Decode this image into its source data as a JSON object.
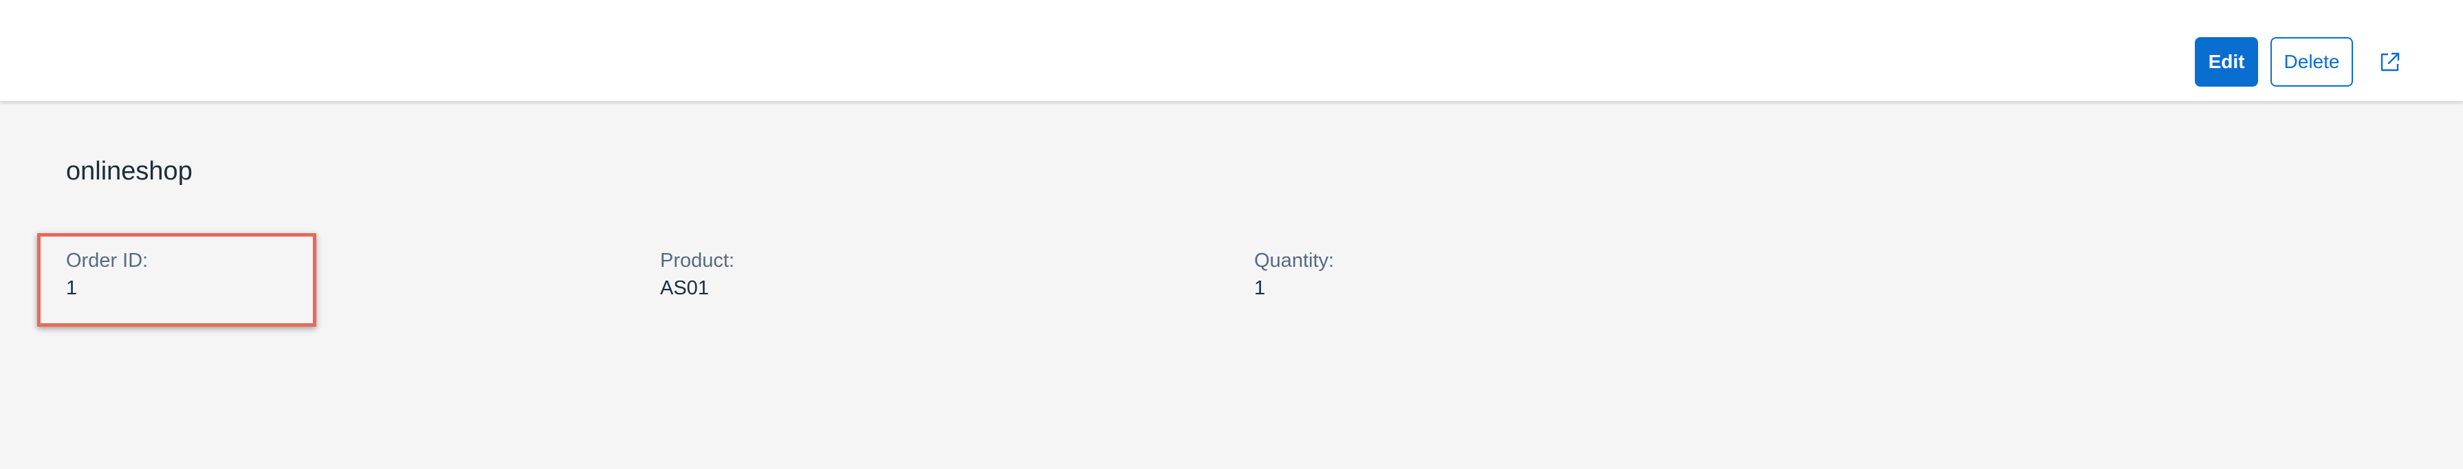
{
  "header": {
    "actions": {
      "edit_label": "Edit",
      "delete_label": "Delete",
      "share_icon": "share-icon"
    }
  },
  "object": {
    "title": "onlineshop",
    "attributes": [
      {
        "label": "Order ID:",
        "value": "1"
      },
      {
        "label": "Product:",
        "value": "AS01"
      },
      {
        "label": "Quantity:",
        "value": "1"
      }
    ]
  },
  "colors": {
    "accent": "#0a6ed1",
    "highlight": "#e8685a",
    "background": "#f5f5f5"
  }
}
